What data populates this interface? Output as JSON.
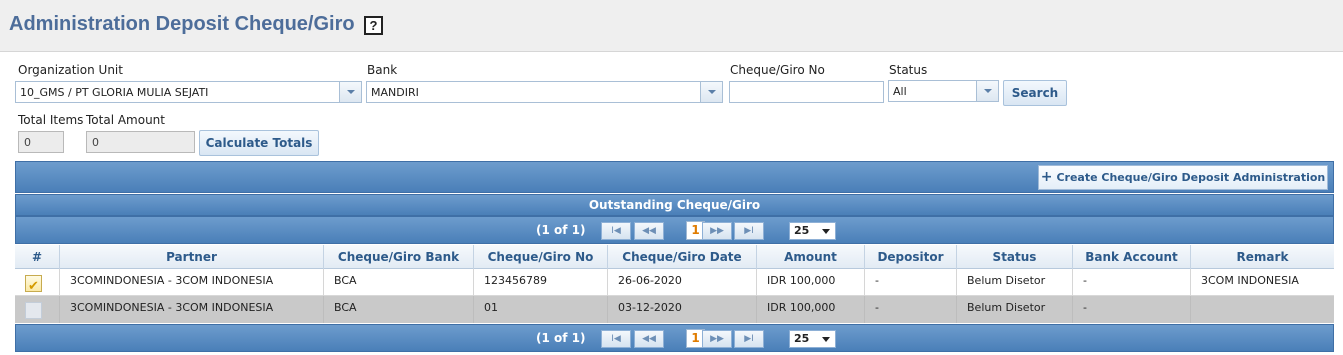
{
  "page": {
    "title": "Administration Deposit Cheque/Giro",
    "help_icon": "?"
  },
  "filters": {
    "org_unit_label": "Organization Unit",
    "org_unit_value": "10_GMS / PT GLORIA MULIA SEJATI",
    "bank_label": "Bank",
    "bank_value": "MANDIRI",
    "cheque_no_label": "Cheque/Giro No",
    "cheque_no_value": "",
    "status_label": "Status",
    "status_value": "All",
    "search_label": "Search"
  },
  "totals": {
    "items_label": "Total Items",
    "amount_label": "Total Amount",
    "items_value": "0",
    "amount_value": "0",
    "calculate_label": "Calculate Totals"
  },
  "toolbar": {
    "create_label": "Create Cheque/Giro Deposit Administration",
    "create_icon": "+"
  },
  "grid": {
    "title": "Outstanding Cheque/Giro",
    "pager": {
      "info": "(1 of 1)",
      "first_icon": "I◀",
      "prev_icon": "◀◀",
      "current_page": "1",
      "next_icon": "▶▶",
      "last_icon": "▶I",
      "page_size": "25"
    },
    "columns": [
      "#",
      "Partner",
      "Cheque/Giro Bank",
      "Cheque/Giro No",
      "Cheque/Giro Date",
      "Amount",
      "Depositor",
      "Status",
      "Bank Account",
      "Remark"
    ],
    "rows": [
      {
        "checked": true,
        "cells": [
          "3COMINDONESIA - 3COM INDONESIA",
          "BCA",
          "123456789",
          "26-06-2020",
          "IDR 100,000",
          "-",
          "Belum Disetor",
          "-",
          "3COM INDONESIA"
        ]
      },
      {
        "checked": false,
        "cells": [
          "3COMINDONESIA - 3COM INDONESIA",
          "BCA",
          "01",
          "03-12-2020",
          "IDR 100,000",
          "-",
          "Belum Disetor",
          "-",
          ""
        ]
      }
    ]
  }
}
